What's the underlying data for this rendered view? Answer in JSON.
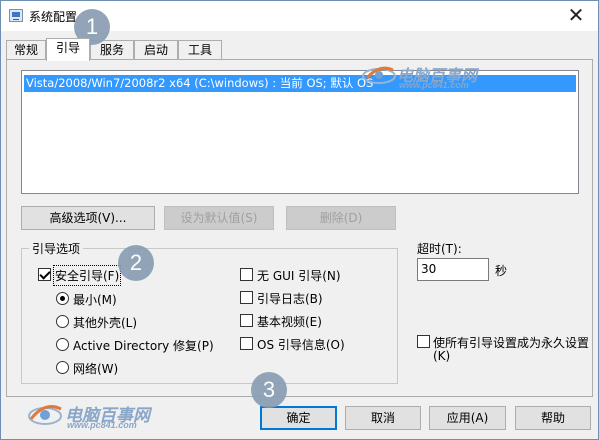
{
  "window": {
    "title": "系统配置",
    "close_glyph": "✕"
  },
  "tabs": [
    {
      "label": "常规",
      "active": false
    },
    {
      "label": "引导",
      "active": true
    },
    {
      "label": "服务",
      "active": false
    },
    {
      "label": "启动",
      "active": false
    },
    {
      "label": "工具",
      "active": false
    }
  ],
  "boot": {
    "os_entries": [
      "Vista/2008/Win7/2008r2 x64 (C:\\windows) : 当前 OS; 默认 OS"
    ],
    "selected_index": 0,
    "buttons": {
      "advanced": "高级选项(V)...",
      "set_default": "设为默认值(S)",
      "delete": "删除(D)"
    },
    "options_group": {
      "title": "引导选项",
      "safe_boot": {
        "label": "安全引导(F)",
        "checked": true
      },
      "radios": [
        {
          "label": "最小(M)",
          "checked": true
        },
        {
          "label": "其他外壳(L)",
          "checked": false
        },
        {
          "label": "Active Directory 修复(P)",
          "checked": false
        },
        {
          "label": "网络(W)",
          "checked": false
        }
      ],
      "checks": [
        {
          "label": "无 GUI 引导(N)",
          "checked": false
        },
        {
          "label": "引导日志(B)",
          "checked": false
        },
        {
          "label": "基本视频(E)",
          "checked": false
        },
        {
          "label": "OS 引导信息(O)",
          "checked": false
        }
      ]
    },
    "timeout": {
      "label": "超时(T):",
      "value": "30",
      "unit": "秒"
    },
    "permanent": {
      "label_line1": "使所有引导设置成为永久设置",
      "label_line2": "(K)",
      "checked": false
    }
  },
  "footer_buttons": {
    "ok": "确定",
    "cancel": "取消",
    "apply": "应用(A)",
    "help": "帮助"
  },
  "annotations": [
    "1",
    "2",
    "3"
  ],
  "watermark": {
    "brand": "电脑百事网",
    "url": "www.pc841.com"
  },
  "colors": {
    "selection": "#3399ff",
    "dialog_bg": "#f0f0f0",
    "default_button_border": "#0078d7",
    "badge": "#8a9db3",
    "watermark": "#8aa6c8"
  }
}
